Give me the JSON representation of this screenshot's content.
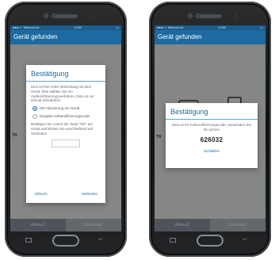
{
  "left_phone": {
    "status": {
      "carrier": "●●●○○ Telekom.de",
      "time": "11:56",
      "battery": "▭"
    },
    "title": "Gerät gefunden",
    "bottom_bar": {
      "abort": "Abbruch",
      "connect": "Verbinden"
    },
    "dialog": {
      "title": "Bestätigung",
      "intro": "Dies ist Ihre erste Verbindung mit dem Gerät, bitte wählen Sie ein Authentifizierungsverfahren. Dies ist nur einmal erforderlich.",
      "option_ok": "OK-Aktivierung am Gerät",
      "option_code": "Eingabe Authentifizierungscode",
      "instructions": "Betätigen Sie zuerst die Taste \"OK\" am Gerät und klicken Sie anschließend auf Verbinden",
      "cancel": "Abbruch",
      "connect": "Verbinden"
    },
    "side_label": "TR"
  },
  "right_phone": {
    "status": {
      "carrier": "●●●○○ Telekom.de",
      "time": "11:56",
      "battery": "▭"
    },
    "title": "Gerät gefunden",
    "bottom_bar": {
      "abort": "Abbruch",
      "connect": "Verbinden"
    },
    "dialog": {
      "title": "Bestätigung",
      "text": "Dies ist Ihr Authentifizierungscode, verwenden Sie ihn sicher!",
      "code": "626032",
      "close": "Schließen"
    },
    "side_label": "TR"
  },
  "colors": {
    "accent": "#1d6aa0",
    "wave": "#e8a617"
  }
}
